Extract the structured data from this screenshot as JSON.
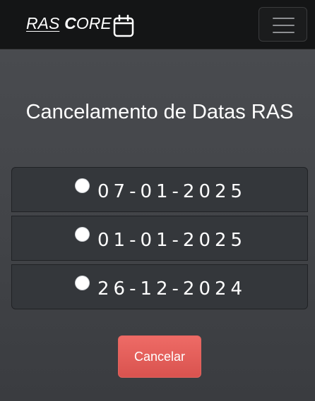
{
  "navbar": {
    "brand_ras": "RAS",
    "brand_core_c": "C",
    "brand_core_rest": "ORE",
    "calendar_icon": "calendar-icon",
    "menu_icon": "hamburger-menu-icon"
  },
  "main": {
    "title": "Cancelamento de Datas RAS",
    "dates": [
      {
        "label": "07-01-2025",
        "selected": false
      },
      {
        "label": "01-01-2025",
        "selected": false
      },
      {
        "label": "26-12-2024",
        "selected": false
      }
    ],
    "cancel_label": "Cancelar"
  },
  "colors": {
    "navbar_bg": "#141516",
    "page_bg": "#45474b",
    "option_bg": "#34373b",
    "cancel_button": "#d9534f"
  }
}
